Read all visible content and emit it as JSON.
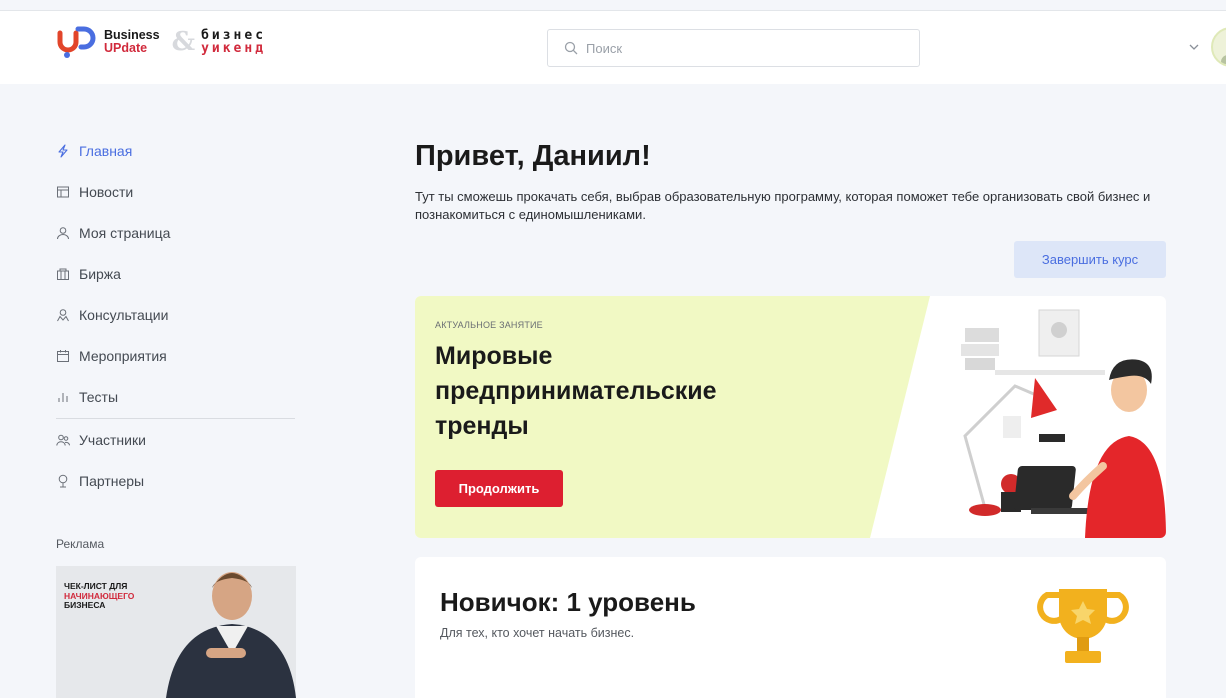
{
  "header": {
    "logo": {
      "brand_line1": "Business",
      "brand_line2": "UPdate",
      "amp": "&",
      "biz_line1": "бизнес",
      "biz_line2": "уикенд"
    },
    "search": {
      "placeholder": "Поиск",
      "value": ""
    },
    "icons": [
      "search-icon",
      "chevron-down-icon",
      "avatar"
    ]
  },
  "sidebar": {
    "items": [
      {
        "label": "Главная",
        "icon": "lightning-icon",
        "active": true
      },
      {
        "label": "Новости",
        "icon": "news-icon",
        "active": false
      },
      {
        "label": "Моя страница",
        "icon": "user-icon",
        "active": false
      },
      {
        "label": "Биржа",
        "icon": "building-icon",
        "active": false
      },
      {
        "label": "Консультации",
        "icon": "consultant-icon",
        "active": false
      },
      {
        "label": "Мероприятия",
        "icon": "calendar-icon",
        "active": false
      },
      {
        "label": "Тесты",
        "icon": "chart-icon",
        "active": false
      },
      {
        "label": "Участники",
        "icon": "users-icon",
        "active": false
      },
      {
        "label": "Партнеры",
        "icon": "partner-icon",
        "active": false
      }
    ],
    "ads_label": "Реклама",
    "ad": {
      "line1": "ЧЕК-ЛИСТ ДЛЯ",
      "line2": "НАЧИНАЮЩЕГО",
      "line3": "БИЗНЕСА"
    }
  },
  "main": {
    "greeting": "Привет, Даниил!",
    "description": "Тут ты сможешь прокачать себя, выбрав образовательную программу, которая поможет тебе организовать свой бизнес и познакомиться с единомышлениками.",
    "finish_button": "Завершить курс",
    "lesson": {
      "tag": "АКТУАЛЬНОЕ ЗАНЯТИЕ",
      "title": "Мировые предпринимательские тренды",
      "continue_button": "Продолжить"
    },
    "level": {
      "title": "Новичок: 1 уровень",
      "description": "Для тех, кто хочет начать бизнес."
    }
  },
  "colors": {
    "accent_blue": "#4a6ee0",
    "brand_red": "#dd1f30",
    "lesson_bg": "#f1f9c4",
    "page_bg": "#f4f6fa"
  }
}
